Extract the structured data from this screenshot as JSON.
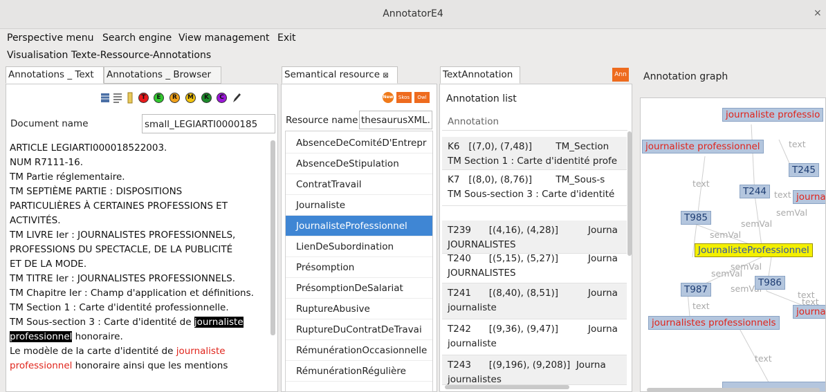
{
  "window": {
    "title": "AnnotatorE4",
    "close": "×"
  },
  "menubar": {
    "items": [
      "Perspective menu",
      "Search engine",
      "View management",
      "Exit"
    ]
  },
  "perspective_title": "Visualisation Texte-Ressource-Annotations",
  "left": {
    "tabs": [
      "Annotations _ Text",
      "Annotations _ Browser"
    ],
    "toolbar": [
      "grid-icon",
      "list-icon",
      "highlighter-icon",
      "T",
      "E",
      "R",
      "M",
      "K",
      "C",
      "pen-icon"
    ],
    "doc_label": "Document name",
    "doc_value": "small_LEGIARTI0000185",
    "text": {
      "l1": "ARTICLE LEGIARTI000018522003.",
      "l2": "NUM R7111-16.",
      "l3": "TM Partie réglementaire.",
      "l4": "TM SEPTIÈME PARTIE : DISPOSITIONS",
      "l5": "PARTICULIÈRES  À CERTAINES PROFESSIONS ET",
      "l6": "ACTIVITÉS.",
      "l7": "TM LIVRE Ier :  JOURNALISTES PROFESSIONNELS,",
      "l8": "PROFESSIONS DU SPECTACLE, DE LA PUBLICITÉ",
      "l9": "ET DE LA MODE.",
      "l10": "TM TITRE Ier : JOURNALISTES PROFESSIONNELS.",
      "l11": "TM Chapitre Ier : Champ d'application et définitions.",
      "l12": "TM Section 1 : Carte d'identité professionnelle.",
      "l13a": "TM Sous-section 3 : Carte d'identité de ",
      "l13b": "journaliste",
      "l14a": "professionnel",
      "l14b": " honoraire.",
      "l15a": "Le modèle de la carte d'identité de ",
      "l15b": "journaliste",
      "l16a": "professionnel",
      "l16b": " honoraire ainsi que les mentions"
    }
  },
  "middle": {
    "tab": "Semantical resource",
    "tab_close": "⊠",
    "buttons": [
      "New",
      "Skos",
      "Owl"
    ],
    "resource_label": "Resource name",
    "resource_value": "thesaurusXML.",
    "items": [
      "AbsenceDeComitéD'Entrepr",
      "AbsenceDeStipulation",
      "ContratTravail",
      "Journaliste",
      "JournalisteProfessionnel",
      "LienDeSubordination",
      "Présomption",
      "PrésomptionDeSalariat",
      "RuptureAbusive",
      "RuptureDuContratDeTravai",
      "RémunérationOccasionnelle",
      "RémunérationRégulière"
    ],
    "selected_index": 4
  },
  "textann": {
    "tab": "TextAnnotation",
    "ann_button": "Ann",
    "list_title": "Annotation list",
    "column": "Annotation",
    "rows": [
      {
        "l1": "K6   [(7,0), (7,48)]        TM_Section",
        "l2": "TM Section 1 : Carte d'identité profe"
      },
      {
        "l1": "K7   [(8,0), (8,76)]        TM_Sous-s",
        "l2": "TM Sous-section 3 : Carte d'identité"
      },
      {
        "l1": "T239      [(4,16), (4,28)]          Journa",
        "l2": "JOURNALISTES"
      },
      {
        "l1": "T240      [(5,15), (5,27)]          Journa",
        "l2": "JOURNALISTES"
      },
      {
        "l1": "T241      [(8,40), (8,51)]          Journa",
        "l2": "journaliste"
      },
      {
        "l1": "T242      [(9,36), (9,47)]          Journa",
        "l2": "journaliste"
      },
      {
        "l1": "T243      [(9,196), (9,208)]  Journa",
        "l2": "journalistes"
      }
    ]
  },
  "graph": {
    "title": "Annotation graph",
    "nodes": {
      "n1": "journaliste professio",
      "n2": "journaliste professionnel",
      "n3": "T245",
      "n4": "T244",
      "n5": "journa",
      "n6": "T985",
      "n7": "JournalisteProfessionnel",
      "n8": "T987",
      "n9": "T986",
      "n10": "journa",
      "n11": "journalistes professionnels"
    },
    "edges": {
      "e1": "text",
      "e2": "text",
      "e3": "text",
      "e4": "semVal",
      "e5": "semVal",
      "e6": "semVal",
      "e7": "semVal",
      "e8": "semVal",
      "e9": "semVal",
      "e10": "text",
      "e11": "text",
      "e12": "text",
      "e13": "text"
    }
  }
}
